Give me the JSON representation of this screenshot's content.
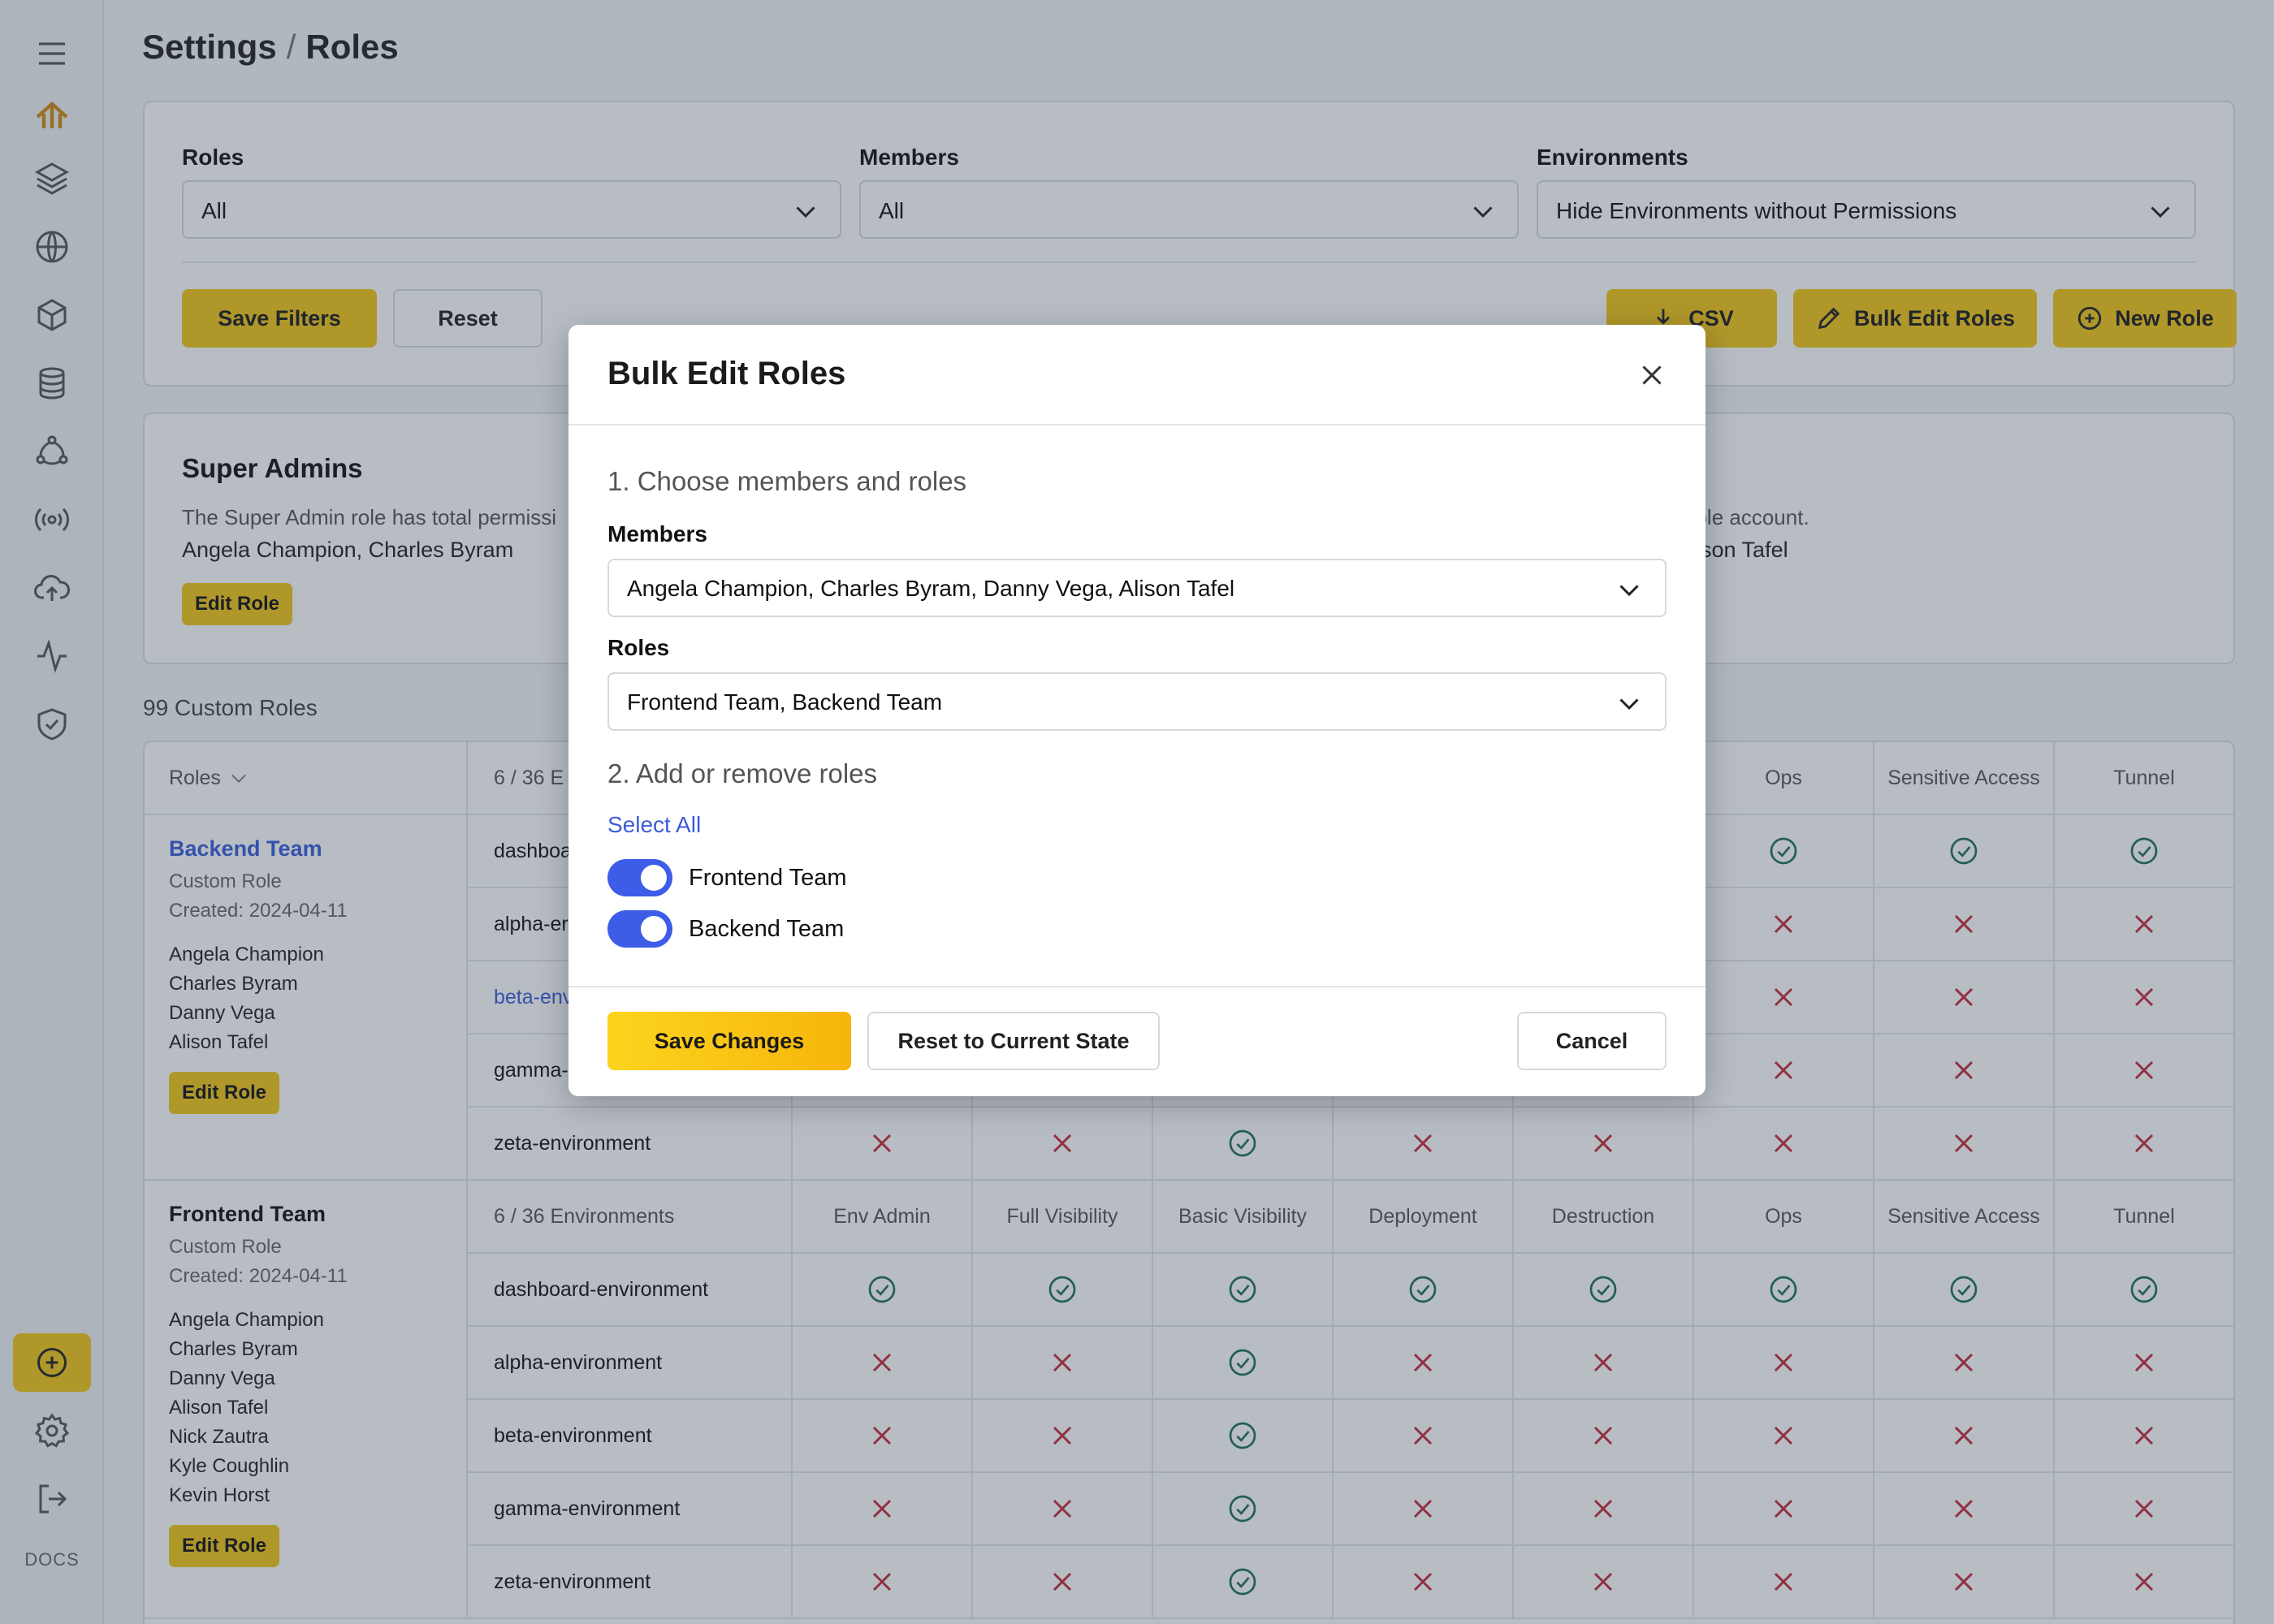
{
  "breadcrumb": {
    "section": "Settings",
    "separator": "/",
    "page": "Roles"
  },
  "sidebar": {
    "docs_label": "DOCS"
  },
  "filters": {
    "roles_label": "Roles",
    "roles_value": "All",
    "members_label": "Members",
    "members_value": "All",
    "environments_label": "Environments",
    "environments_value": "Hide Environments without Permissions",
    "save_filters": "Save Filters",
    "reset": "Reset",
    "csv": "CSV",
    "bulk_edit": "Bulk Edit Roles",
    "new_role": "New Role"
  },
  "super_admins": {
    "title": "Super Admins",
    "description_start": "The Super Admin role has total permissi",
    "description_end": "otible account.",
    "members_start": "Angela Champion, Charles Byram",
    "members_end": "Alison Tafel",
    "edit": "Edit Role"
  },
  "custom_roles_count": "99 Custom Roles",
  "table": {
    "roles_header": "Roles",
    "columns": [
      "Env Admin",
      "Full Visibility",
      "Basic Visibility",
      "Deployment",
      "Destruction",
      "Ops",
      "Sensitive Access",
      "Tunnel"
    ],
    "roles": [
      {
        "name": "Backend Team",
        "type": "Custom Role",
        "created": "Created: 2024-04-11",
        "members": [
          "Angela Champion",
          "Charles Byram",
          "Danny Vega",
          "Alison Tafel"
        ],
        "edit": "Edit Role",
        "env_count": "6 / 36 E",
        "envs": [
          {
            "name": "dashboa",
            "perms": [
              1,
              1,
              1,
              1,
              1,
              1,
              1,
              1
            ]
          },
          {
            "name": "alpha-er",
            "perms": [
              0,
              0,
              1,
              0,
              0,
              0,
              0,
              0
            ]
          },
          {
            "name": "beta-env",
            "perms": [
              0,
              0,
              1,
              0,
              0,
              0,
              0,
              0
            ]
          },
          {
            "name": "gamma-",
            "perms": [
              0,
              0,
              1,
              0,
              0,
              0,
              0,
              0
            ]
          },
          {
            "name": "zeta-environment",
            "perms": [
              0,
              0,
              1,
              0,
              0,
              0,
              0,
              0
            ]
          }
        ]
      },
      {
        "name": "Frontend Team",
        "type": "Custom Role",
        "created": "Created: 2024-04-11",
        "members": [
          "Angela Champion",
          "Charles Byram",
          "Danny Vega",
          "Alison Tafel",
          "Nick Zautra",
          "Kyle Coughlin",
          "Kevin Horst"
        ],
        "edit": "Edit Role",
        "env_count": "6 / 36 Environments",
        "envs": [
          {
            "name": "dashboard-environment",
            "perms": [
              1,
              1,
              1,
              1,
              1,
              1,
              1,
              1
            ]
          },
          {
            "name": "alpha-environment",
            "perms": [
              0,
              0,
              1,
              0,
              0,
              0,
              0,
              0
            ]
          },
          {
            "name": "beta-environment",
            "perms": [
              0,
              0,
              1,
              0,
              0,
              0,
              0,
              0
            ]
          },
          {
            "name": "gamma-environment",
            "perms": [
              0,
              0,
              1,
              0,
              0,
              0,
              0,
              0
            ]
          },
          {
            "name": "zeta-environment",
            "perms": [
              0,
              0,
              1,
              0,
              0,
              0,
              0,
              0
            ]
          }
        ]
      }
    ]
  },
  "modal": {
    "title": "Bulk Edit Roles",
    "step1": "1. Choose members and roles",
    "members_label": "Members",
    "members_value": "Angela Champion, Charles Byram, Danny Vega, Alison Tafel",
    "roles_label": "Roles",
    "roles_value": "Frontend Team, Backend Team",
    "step2": "2. Add or remove roles",
    "select_all": "Select All",
    "toggles": [
      {
        "label": "Frontend Team",
        "on": true
      },
      {
        "label": "Backend Team",
        "on": true
      }
    ],
    "save": "Save Changes",
    "reset": "Reset to Current State",
    "cancel": "Cancel"
  },
  "colors": {
    "accent": "#f5c518",
    "toggle": "#3d5ce8",
    "check": "#1f6f52",
    "cross": "#c62b3a",
    "link": "#3b5bdb"
  }
}
